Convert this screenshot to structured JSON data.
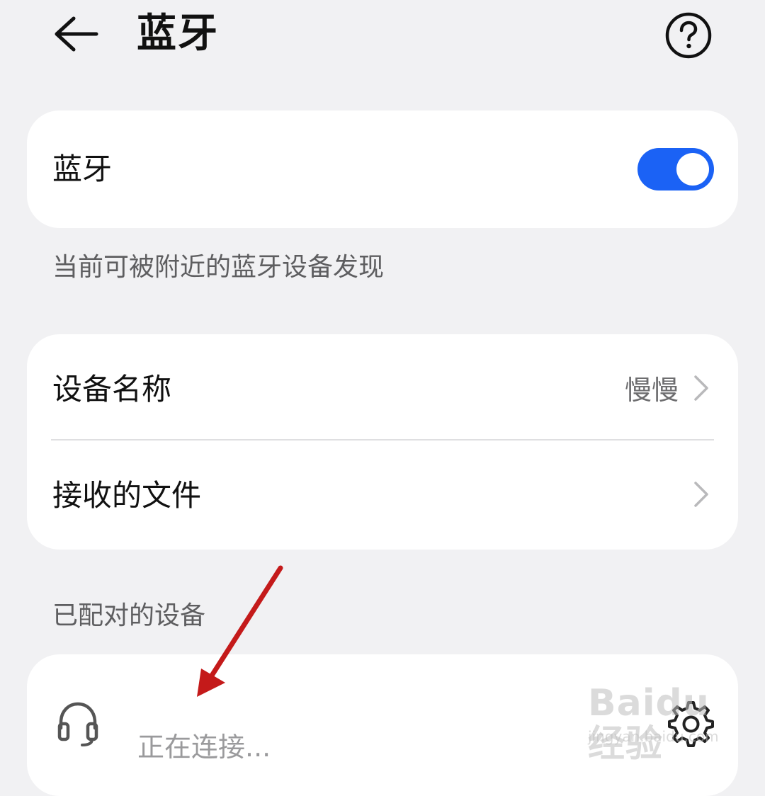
{
  "header": {
    "title": "蓝牙",
    "back_icon": "arrow-left-icon",
    "help_icon": "question-circle-icon"
  },
  "bluetooth_card": {
    "label": "蓝牙",
    "toggle_on": true,
    "toggle_color": "#1b62f5"
  },
  "visibility_hint": "当前可被附近的蓝牙设备发现",
  "options": [
    {
      "label": "设备名称",
      "value": "慢慢"
    },
    {
      "label": "接收的文件",
      "value": ""
    }
  ],
  "paired_section": {
    "title": "已配对的设备",
    "devices": [
      {
        "icon": "headset-icon",
        "status": "正在连接...",
        "settings_icon": "gear-icon"
      }
    ]
  },
  "annotation_color": "#c41a1a",
  "watermark": {
    "logo": "Baidu经验",
    "url": "jingyan.baidu.com"
  }
}
